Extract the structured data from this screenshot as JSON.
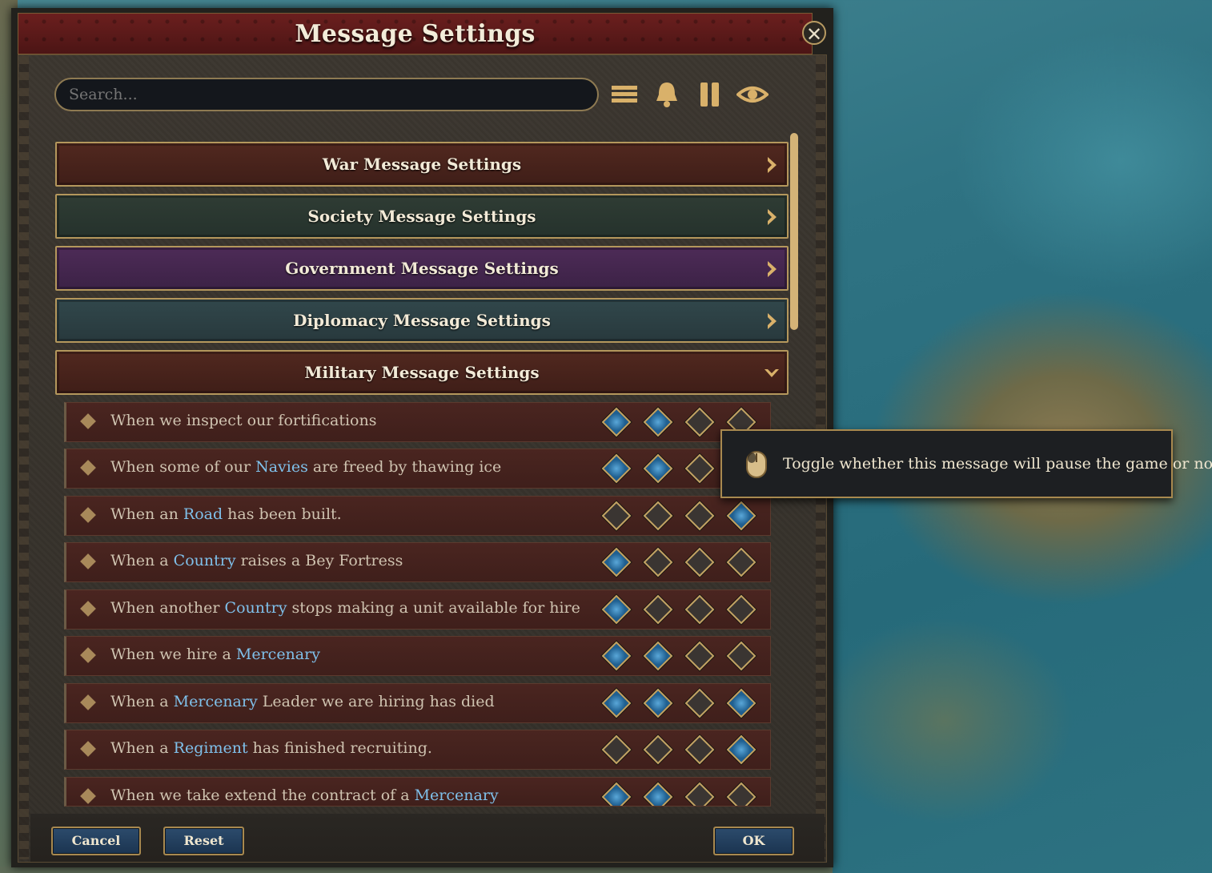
{
  "window": {
    "title": "Message Settings"
  },
  "search": {
    "placeholder": "Search..."
  },
  "filter_icons": [
    "list-icon",
    "bell-icon",
    "pause-icon",
    "eye-icon"
  ],
  "categories": [
    {
      "label": "War Message Settings",
      "state": "collapsed"
    },
    {
      "label": "Society Message Settings",
      "state": "collapsed"
    },
    {
      "label": "Government Message Settings",
      "state": "collapsed"
    },
    {
      "label": "Diplomacy Message Settings",
      "state": "collapsed"
    },
    {
      "label": "Military Message Settings",
      "state": "expanded"
    }
  ],
  "messages": [
    {
      "parts": [
        {
          "t": "When we inspect our fortifications"
        }
      ],
      "toggles": [
        true,
        true,
        false,
        false
      ]
    },
    {
      "parts": [
        {
          "t": "When some of our "
        },
        {
          "t": "Navies",
          "hl": true
        },
        {
          "t": " are freed by thawing ice"
        }
      ],
      "toggles": [
        true,
        true,
        false,
        false
      ]
    },
    {
      "parts": [
        {
          "t": "When an "
        },
        {
          "t": "Road",
          "hl": true
        },
        {
          "t": " has been built."
        }
      ],
      "toggles": [
        false,
        false,
        false,
        true
      ]
    },
    {
      "parts": [
        {
          "t": "When a "
        },
        {
          "t": "Country",
          "hl": true
        },
        {
          "t": " raises a Bey Fortress"
        }
      ],
      "toggles": [
        true,
        false,
        false,
        false
      ]
    },
    {
      "parts": [
        {
          "t": "When another "
        },
        {
          "t": "Country",
          "hl": true
        },
        {
          "t": " stops making a unit available for hire"
        }
      ],
      "toggles": [
        true,
        false,
        false,
        false
      ]
    },
    {
      "parts": [
        {
          "t": "When we hire a "
        },
        {
          "t": "Mercenary",
          "hl": true
        }
      ],
      "toggles": [
        true,
        true,
        false,
        false
      ]
    },
    {
      "parts": [
        {
          "t": "When a "
        },
        {
          "t": "Mercenary",
          "hl": true
        },
        {
          "t": " Leader we are hiring has died"
        }
      ],
      "toggles": [
        true,
        true,
        false,
        true
      ]
    },
    {
      "parts": [
        {
          "t": "When a "
        },
        {
          "t": "Regiment",
          "hl": true
        },
        {
          "t": " has finished recruiting."
        }
      ],
      "toggles": [
        false,
        false,
        false,
        true
      ]
    },
    {
      "parts": [
        {
          "t": "When we take extend the contract of a "
        },
        {
          "t": "Mercenary",
          "hl": true
        }
      ],
      "toggles": [
        true,
        true,
        false,
        false
      ]
    }
  ],
  "tooltip": {
    "icon": "mouse-icon",
    "text": "Toggle whether this message will pause the game or not"
  },
  "buttons": {
    "cancel": "Cancel",
    "reset": "Reset",
    "ok": "OK"
  },
  "colors": {
    "toggle_on": "#2f80bf",
    "toggle_border": "#c3a363",
    "highlight_text": "#7fc0ea",
    "button_blue": "#2c4b6c"
  }
}
